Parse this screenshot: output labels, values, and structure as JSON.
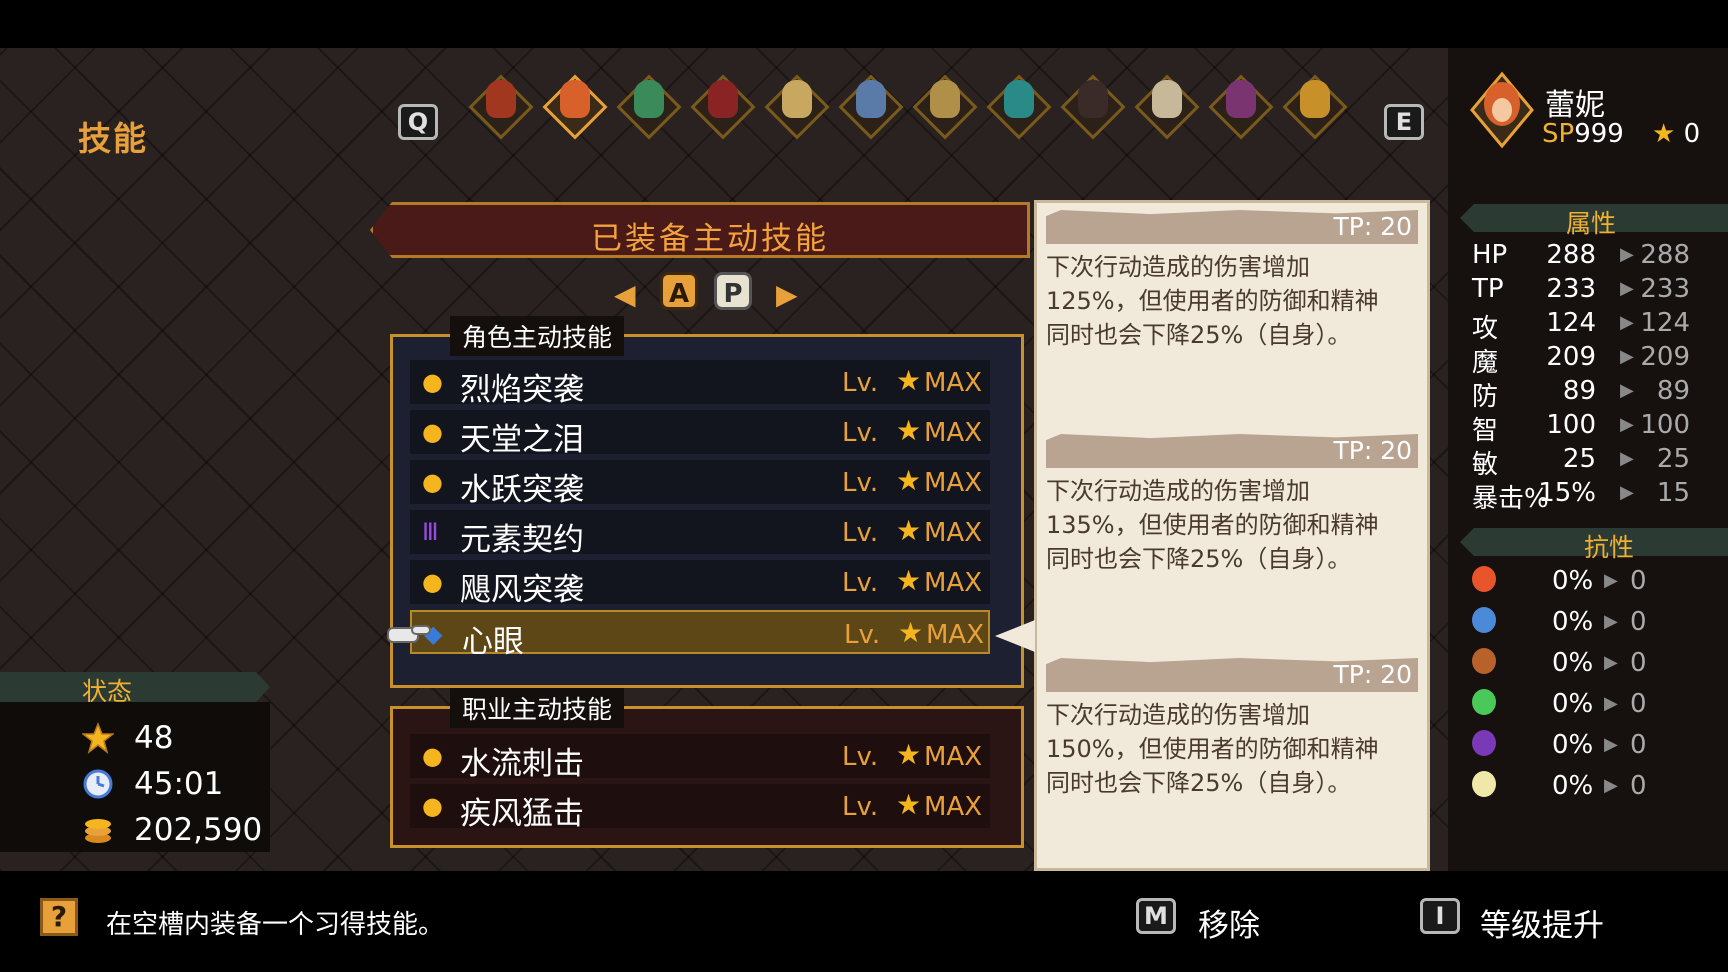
{
  "header": {
    "title": "技能",
    "prev_key": "Q",
    "next_key": "E"
  },
  "characters": [
    {
      "id": "c1",
      "color": "#a0371e"
    },
    {
      "id": "c2",
      "color": "#d8602a",
      "selected": true
    },
    {
      "id": "c3",
      "color": "#3a8a5a"
    },
    {
      "id": "c4",
      "color": "#8a2424"
    },
    {
      "id": "c5",
      "color": "#c8a860"
    },
    {
      "id": "c6",
      "color": "#5a7aa8"
    },
    {
      "id": "c7",
      "color": "#b09048"
    },
    {
      "id": "c8",
      "color": "#2a8a88"
    },
    {
      "id": "c9",
      "color": "#3a2a28"
    },
    {
      "id": "c10",
      "color": "#c8b89a"
    },
    {
      "id": "c11",
      "color": "#7a3470"
    },
    {
      "id": "c12",
      "color": "#c89028"
    }
  ],
  "hero": {
    "name": "蕾妮",
    "sp_label": "SP",
    "sp_value": "999",
    "star_value": "0"
  },
  "skills_panel": {
    "title": "已装备主动技能",
    "tab_a": "A",
    "tab_p": "P",
    "character_label": "角色主动技能",
    "class_label": "职业主动技能",
    "lv_label": "Lv.",
    "max_label": "MAX",
    "character_skills": [
      {
        "name": "烈焰突袭",
        "icon": "bulb-icon"
      },
      {
        "name": "天堂之泪",
        "icon": "bulb-icon"
      },
      {
        "name": "水跃突袭",
        "icon": "bulb-icon"
      },
      {
        "name": "元素契约",
        "icon": "triple-bar-icon"
      },
      {
        "name": "飓风突袭",
        "icon": "bulb-icon"
      },
      {
        "name": "心眼",
        "icon": "eye-icon",
        "selected": true
      }
    ],
    "class_skills": [
      {
        "name": "水流刺击",
        "icon": "bulb-icon"
      },
      {
        "name": "疾风猛击",
        "icon": "bulb-icon"
      }
    ]
  },
  "descriptions": [
    {
      "tp": "TP: 20",
      "lines": [
        "下次行动造成的伤害增加",
        "125%，但使用者的防御和精神",
        "同时也会下降25%（自身）。"
      ]
    },
    {
      "tp": "TP: 20",
      "lines": [
        "下次行动造成的伤害增加",
        "135%，但使用者的防御和精神",
        "同时也会下降25%（自身）。"
      ]
    },
    {
      "tp": "TP: 20",
      "lines": [
        "下次行动造成的伤害增加",
        "150%，但使用者的防御和精神",
        "同时也会下降25%（自身）。"
      ]
    }
  ],
  "attributes": {
    "title": "属性",
    "rows": [
      {
        "key": "HP",
        "current": "288",
        "next": "288"
      },
      {
        "key": "TP",
        "current": "233",
        "next": "233"
      },
      {
        "key": "攻",
        "current": "124",
        "next": "124"
      },
      {
        "key": "魔",
        "current": "209",
        "next": "209"
      },
      {
        "key": "防",
        "current": "89",
        "next": "89"
      },
      {
        "key": "智",
        "current": "100",
        "next": "100"
      },
      {
        "key": "敏",
        "current": "25",
        "next": "25"
      },
      {
        "key": "暴击%",
        "current": "15%",
        "next": "15"
      }
    ]
  },
  "resistances": {
    "title": "抗性",
    "rows": [
      {
        "icon": "fire-icon",
        "color": "#e8552a",
        "current": "0%",
        "next": "0"
      },
      {
        "icon": "water-icon",
        "color": "#4a8ad8",
        "current": "0%",
        "next": "0"
      },
      {
        "icon": "earth-icon",
        "color": "#b8612a",
        "current": "0%",
        "next": "0"
      },
      {
        "icon": "wind-icon",
        "color": "#4ac85a",
        "current": "0%",
        "next": "0"
      },
      {
        "icon": "dark-icon",
        "color": "#7a3ab8",
        "current": "0%",
        "next": "0"
      },
      {
        "icon": "light-icon",
        "color": "#f0e8a8",
        "current": "0%",
        "next": "0"
      }
    ]
  },
  "status": {
    "title": "状态",
    "stars": "48",
    "time": "45:01",
    "gold": "202,590"
  },
  "footer": {
    "hint_icon": "?",
    "hint": "在空槽内装备一个习得技能。",
    "remove_key": "M",
    "remove_label": "移除",
    "levelup_key": "I",
    "levelup_label": "等级提升"
  },
  "colors": {
    "accent": "#e8a13a",
    "star": "#f5b51e"
  }
}
